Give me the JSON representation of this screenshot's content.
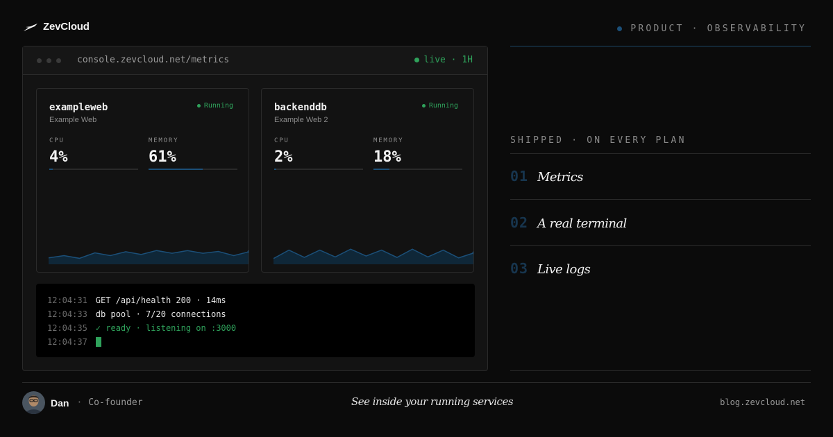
{
  "brand": {
    "name": "ZevCloud",
    "icon": "swoosh-logo-icon"
  },
  "kicker": {
    "text": "PRODUCT · OBSERVABILITY",
    "dot_color": "#1b4f78"
  },
  "console": {
    "url": "console.zevcloud.net/metrics",
    "live_label": "live · 1H",
    "services": [
      {
        "name": "exampleweb",
        "subtitle": "Example Web",
        "status": "Running",
        "cpu_label": "CPU",
        "cpu_value": "4%",
        "cpu_fraction": 0.04,
        "memory_label": "MEMORY",
        "memory_value": "61%",
        "memory_fraction": 0.61,
        "sparkline": [
          0.28,
          0.38,
          0.26,
          0.5,
          0.38,
          0.55,
          0.43,
          0.6,
          0.48,
          0.6,
          0.48,
          0.56,
          0.38,
          0.55
        ]
      },
      {
        "name": "backenddb",
        "subtitle": "Example Web 2",
        "status": "Running",
        "cpu_label": "CPU",
        "cpu_value": "2%",
        "cpu_fraction": 0.02,
        "memory_label": "MEMORY",
        "memory_value": "18%",
        "memory_fraction": 0.18,
        "sparkline": [
          0.25,
          0.62,
          0.3,
          0.62,
          0.32,
          0.66,
          0.36,
          0.62,
          0.3,
          0.66,
          0.32,
          0.62,
          0.28,
          0.5
        ]
      }
    ],
    "logs": [
      {
        "time": "12:04:31",
        "message": "GET /api/health 200 · 14ms",
        "style": "normal"
      },
      {
        "time": "12:04:33",
        "message": "db pool · 7/20 connections",
        "style": "normal"
      },
      {
        "time": "12:04:35",
        "message": "✓ ready · listening on :3000",
        "style": "ok"
      },
      {
        "time": "12:04:37",
        "message": "",
        "style": "cursor"
      }
    ]
  },
  "features": {
    "heading": "SHIPPED · ON EVERY PLAN",
    "items": [
      {
        "num": "01",
        "label": "Metrics"
      },
      {
        "num": "02",
        "label": "A real terminal"
      },
      {
        "num": "03",
        "label": "Live logs"
      }
    ]
  },
  "footer": {
    "author_name": "Dan",
    "separator": "·",
    "author_role": "Co-founder",
    "tagline": "See inside your running services",
    "domain": "blog.zevcloud.net"
  },
  "colors": {
    "accent": "#1b4f78",
    "live_green": "#2fa25b",
    "background": "#0b0b0b"
  }
}
